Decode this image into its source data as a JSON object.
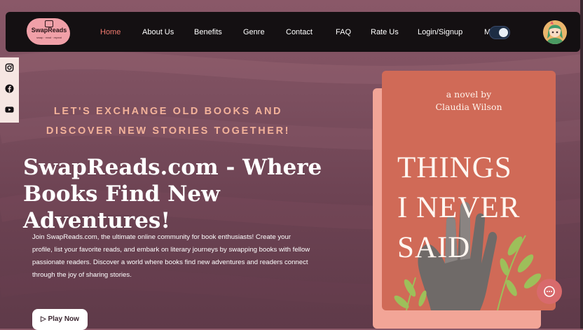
{
  "nav": {
    "logo_text": "SwapReads",
    "logo_tag": "swap · read · repeat",
    "items": [
      {
        "label": "Home"
      },
      {
        "label": "About Us"
      },
      {
        "label": "Benefits"
      },
      {
        "label": "Genre"
      },
      {
        "label": "Contact"
      },
      {
        "label": "FAQ"
      },
      {
        "label": "Rate Us"
      },
      {
        "label": "Login/Signup"
      },
      {
        "label": "M"
      }
    ],
    "active_item": "Home",
    "theme_toggle": "dark"
  },
  "social": [
    "instagram-icon",
    "facebook-icon",
    "youtube-icon"
  ],
  "hero": {
    "tagline_line1": "LET'S EXCHANGE OLD BOOKS AND",
    "tagline_line2": "DISCOVER NEW STORIES TOGETHER!",
    "headline_line1": "SwapReads.com - Where",
    "headline_line2": "Books Find New Adventures!",
    "description": "Join SwapReads.com, the ultimate online community for book enthusiasts! Create your profile, list your favorite reads, and embark on literary journeys by swapping books with fellow passionate readers. Discover a world where books find new adventures and readers connect through the joy of sharing stories.",
    "play_button": "▷ Play Now"
  },
  "book": {
    "subtitle_line1": "a novel by",
    "subtitle_line2": "Claudia Wilson",
    "title_line1": "THINGS",
    "title_line2": "I NEVER",
    "title_line3": "SAID"
  },
  "colors": {
    "accent": "#f07a6e",
    "tagline": "#f3b29a",
    "nav_bg": "#141012",
    "book_cover": "#d06a57"
  }
}
